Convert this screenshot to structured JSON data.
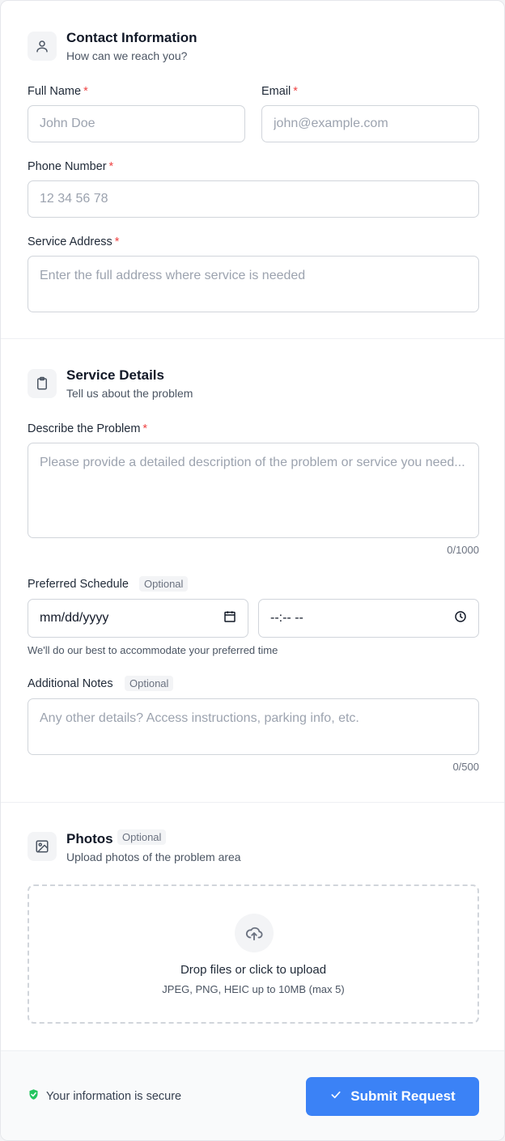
{
  "contact": {
    "title": "Contact Information",
    "subtitle": "How can we reach you?",
    "icon": "user-icon",
    "full_name": {
      "label": "Full Name",
      "required": "*",
      "placeholder": "John Doe",
      "value": ""
    },
    "email": {
      "label": "Email",
      "required": "*",
      "placeholder": "john@example.com",
      "value": ""
    },
    "phone": {
      "label": "Phone Number",
      "required": "*",
      "placeholder": "12 34 56 78",
      "value": ""
    },
    "address": {
      "label": "Service Address",
      "required": "*",
      "placeholder": "Enter the full address where service is needed",
      "value": ""
    }
  },
  "service": {
    "title": "Service Details",
    "subtitle": "Tell us about the problem",
    "icon": "clipboard-icon",
    "problem": {
      "label": "Describe the Problem",
      "required": "*",
      "placeholder": "Please provide a detailed description of the problem or service you need...",
      "value": "",
      "counter": "0/1000"
    },
    "schedule": {
      "label": "Preferred Schedule",
      "badge": "Optional",
      "date_value": "mm/dd/yyyy",
      "time_value": "--:-- --",
      "hint": "We'll do our best to accommodate your preferred time"
    },
    "notes": {
      "label": "Additional Notes",
      "badge": "Optional",
      "placeholder": "Any other details? Access instructions, parking info, etc.",
      "value": "",
      "counter": "0/500"
    }
  },
  "photos": {
    "title": "Photos",
    "badge": "Optional",
    "subtitle": "Upload photos of the problem area",
    "icon": "image-icon",
    "drop_title": "Drop files or click to upload",
    "drop_sub": "JPEG, PNG, HEIC up to 10MB (max 5)"
  },
  "footer": {
    "secure_text": "Your information is secure",
    "submit_label": "Submit Request"
  },
  "colors": {
    "accent": "#3b82f6",
    "required": "#ef4444",
    "secure": "#22c55e"
  }
}
